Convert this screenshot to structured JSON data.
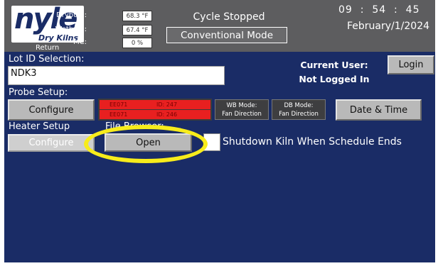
{
  "header": {
    "logo_text": "nyle",
    "logo_subtext": "Dry Kilns",
    "return_label": "Return",
    "probes": [
      {
        "label": "Drybulb:",
        "value": "68.3 °F"
      },
      {
        "label": "Wetbulb:",
        "value": "67.4 °F"
      },
      {
        "label": "MC:",
        "value": "0 %"
      }
    ],
    "cycle_status": "Cycle Stopped",
    "mode_button_label": "Conventional Mode",
    "clock": "09  :  54  :  45    AM",
    "date": "February/1/2024"
  },
  "lot": {
    "label": "Lot ID Selection:",
    "value": "NDK3"
  },
  "user": {
    "title": "Current User:",
    "value": "Not Logged In",
    "login_label": "Login"
  },
  "probe_setup": {
    "label": "Probe Setup:",
    "configure_label": "Configure",
    "rows": [
      {
        "code": "EE071",
        "id": "ID:   247"
      },
      {
        "code": "EE071",
        "id": "ID:   246"
      }
    ],
    "wb_mode_title": "WB Mode:",
    "wb_mode_value": "Fan Direction",
    "db_mode_title": "DB Mode:",
    "db_mode_value": "Fan Direction",
    "date_time_label": "Date & Time"
  },
  "heater_setup": {
    "label": "Heater Setup",
    "configure_label": "Configure",
    "file_browser_label": "File Browser:",
    "open_label": "Open",
    "shutdown_label": "Shutdown Kiln When Schedule Ends"
  },
  "colors": {
    "panel_blue": "#1a2c66",
    "header_gray": "#5d5d5f",
    "highlight_yellow": "#f7ec1b",
    "probe_red": "#e82020"
  }
}
